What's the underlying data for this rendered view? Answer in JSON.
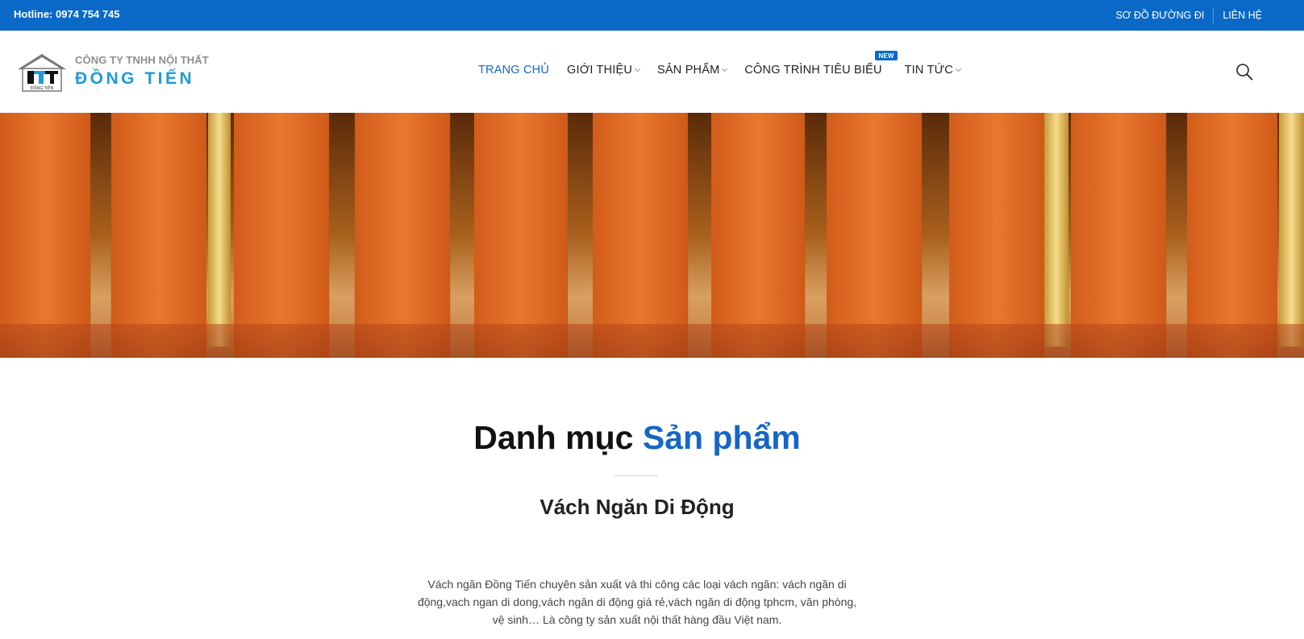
{
  "topbar": {
    "hotline": "Hotline: 0974 754 745",
    "links": [
      "SƠ ĐỒ ĐƯỜNG ĐI",
      "LIÊN HỆ"
    ],
    "background": "#0a69c7"
  },
  "logo": {
    "line1": "CÔNG TY TNHH NỘI THẤT",
    "line2": "ĐỒNG TIẾN",
    "mark_caption": "ĐỒNG TIẾN"
  },
  "nav": {
    "items": [
      {
        "label": "TRANG CHỦ",
        "active": true,
        "has_dropdown": false
      },
      {
        "label": "GIỚI THIỆU",
        "active": false,
        "has_dropdown": true
      },
      {
        "label": "SẢN PHẨM",
        "active": false,
        "has_dropdown": true
      },
      {
        "label": "CÔNG TRÌNH TIÊU BIỂU",
        "active": false,
        "has_dropdown": false,
        "badge": "NEW"
      },
      {
        "label": "TIN TỨC",
        "active": false,
        "has_dropdown": true
      }
    ],
    "search_icon": "search-icon"
  },
  "section": {
    "title_plain": "Danh mục",
    "title_highlight": "Sản phẩm",
    "subtitle": "Vách Ngăn Di Động",
    "description": "Vách ngăn Đồng Tiến chuyên sản xuất và thi công các loại vách ngăn: vách ngăn di động,vach ngan di dong,vách ngăn di động giá rẻ,vách ngăn di động tphcm, văn phòng, vệ sinh… Là công ty sản xuất nội thất hàng đầu Việt nam."
  },
  "colors": {
    "accent": "#1566c6",
    "logo_blue": "#1e9bd7",
    "banner_orange": "#e0702a"
  }
}
